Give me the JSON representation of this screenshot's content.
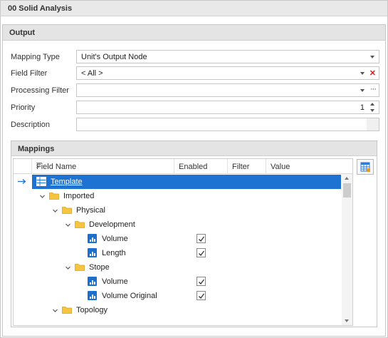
{
  "window": {
    "title": "00 Solid Analysis"
  },
  "output": {
    "header": "Output",
    "mapping_type": {
      "label": "Mapping Type",
      "value": "Unit's Output Node"
    },
    "field_filter": {
      "label": "Field Filter",
      "value": "< All >"
    },
    "processing_filter": {
      "label": "Processing Filter",
      "value": ""
    },
    "priority": {
      "label": "Priority",
      "value": "1"
    },
    "description": {
      "label": "Description",
      "value": ""
    }
  },
  "mappings": {
    "header": "Mappings",
    "columns": [
      "Field Name",
      "Enabled",
      "Filter",
      "Value"
    ],
    "rows": [
      {
        "label": "Template",
        "kind": "table",
        "level": 0,
        "expanded": true,
        "selected": true,
        "enabled": null
      },
      {
        "label": "Imported",
        "kind": "folder",
        "level": 1,
        "expanded": true,
        "selected": false,
        "enabled": null
      },
      {
        "label": "Physical",
        "kind": "folder",
        "level": 2,
        "expanded": true,
        "selected": false,
        "enabled": null
      },
      {
        "label": "Development",
        "kind": "folder",
        "level": 3,
        "expanded": true,
        "selected": false,
        "enabled": null
      },
      {
        "label": "Volume",
        "kind": "field",
        "level": 4,
        "expanded": false,
        "selected": false,
        "enabled": true
      },
      {
        "label": "Length",
        "kind": "field",
        "level": 4,
        "expanded": false,
        "selected": false,
        "enabled": true
      },
      {
        "label": "Stope",
        "kind": "folder",
        "level": 3,
        "expanded": true,
        "selected": false,
        "enabled": null
      },
      {
        "label": "Volume",
        "kind": "field",
        "level": 4,
        "expanded": false,
        "selected": false,
        "enabled": true
      },
      {
        "label": "Volume Original",
        "kind": "field",
        "level": 4,
        "expanded": false,
        "selected": false,
        "enabled": true
      },
      {
        "label": "Topology",
        "kind": "folder",
        "level": 2,
        "expanded": true,
        "selected": false,
        "enabled": null
      }
    ]
  },
  "icons": {
    "folder": "folder-icon",
    "table": "table-icon",
    "field": "numeric-field-icon",
    "row_indicator": "arrow-right-icon",
    "grid_settings": "grid-layout-icon"
  },
  "colors": {
    "selection": "#1e73d2",
    "folder": "#f5c542",
    "field_icon": "#1d6fce",
    "clear": "#d42020"
  }
}
